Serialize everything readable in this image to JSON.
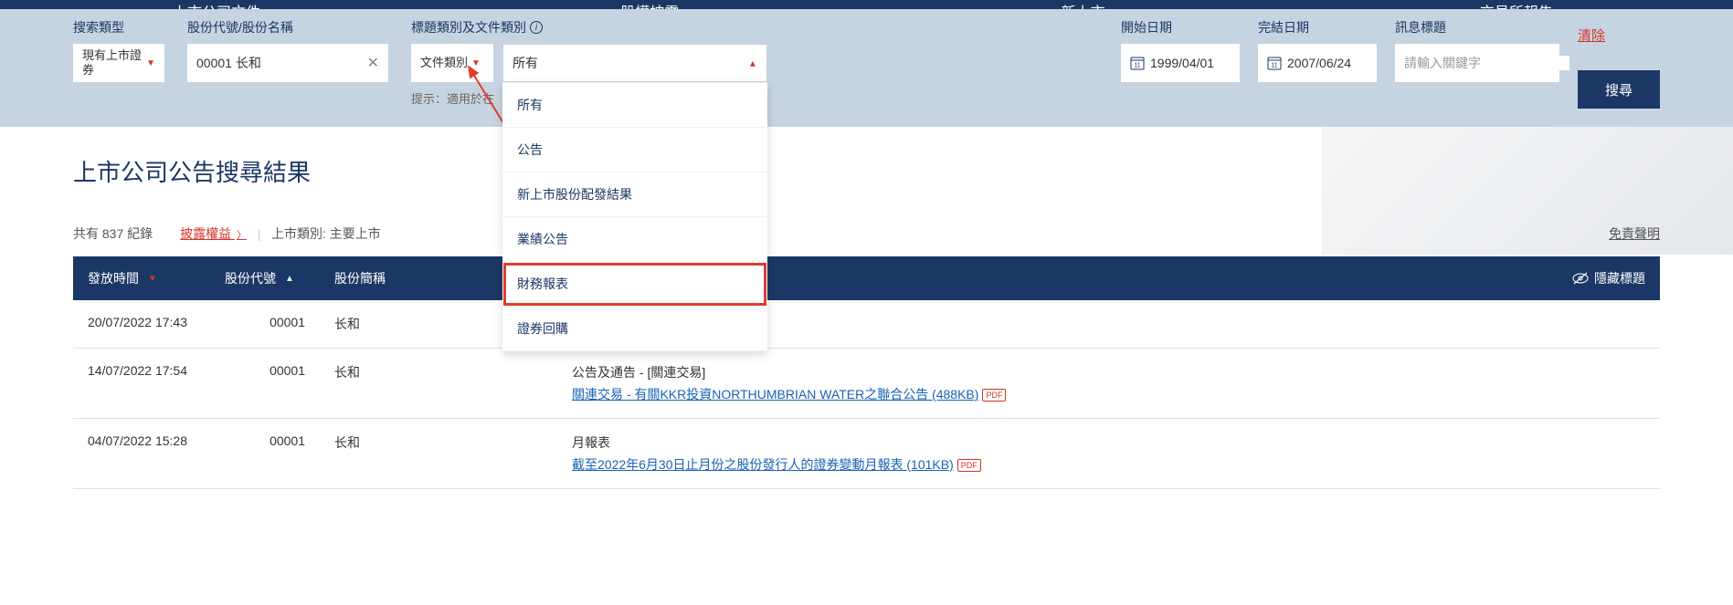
{
  "nav": {
    "items": [
      "上市公司文件",
      "股權披露",
      "新上市",
      "交易所報告"
    ]
  },
  "search": {
    "type_label": "搜索類型",
    "type_value": "現有上市證券",
    "stock_label": "股份代號/股份名稱",
    "stock_value": "00001 长和",
    "category_label": "標題類別及文件類別",
    "category_value": "文件類別",
    "category_hint": "提示：適用於在",
    "subcat_value": "所有",
    "start_label": "開始日期",
    "start_value": "1999/04/01",
    "end_label": "完結日期",
    "end_value": "2007/06/24",
    "keyword_label": "訊息標題",
    "keyword_placeholder": "請輸入關鍵字",
    "clear": "清除",
    "submit": "搜尋",
    "dropdown_options": [
      "所有",
      "公告",
      "新上市股份配發結果",
      "業績公告",
      "財務報表",
      "證券回購"
    ]
  },
  "results": {
    "title": "上市公司公告搜尋結果",
    "count_prefix": "共有",
    "count": "837",
    "count_suffix": "紀錄",
    "disclosure_link": "披露權益",
    "list_type_label": "上市類別:",
    "list_type_value": "主要上市",
    "disclaimer": "免責聲明",
    "headers": {
      "time": "發放時間",
      "code": "股份代號",
      "name": "股份簡稱",
      "hide": "隱藏標題"
    },
    "rows": [
      {
        "time": "20/07/2022 17:43",
        "code": "00001",
        "name": "长和",
        "cat": "",
        "link": "",
        "size": "",
        "pdf_badge_only": true
      },
      {
        "time": "14/07/2022 17:54",
        "code": "00001",
        "name": "长和",
        "cat": "公告及通告 - [關連交易]",
        "link": "關連交易 - 有關KKR投資NORTHUMBRIAN WATER之聯合公告 (488KB)",
        "pdf": true
      },
      {
        "time": "04/07/2022 15:28",
        "code": "00001",
        "name": "长和",
        "cat": "月報表",
        "link": "截至2022年6月30日止月份之股份發行人的證券變動月報表 (101KB)",
        "pdf": true
      }
    ]
  }
}
